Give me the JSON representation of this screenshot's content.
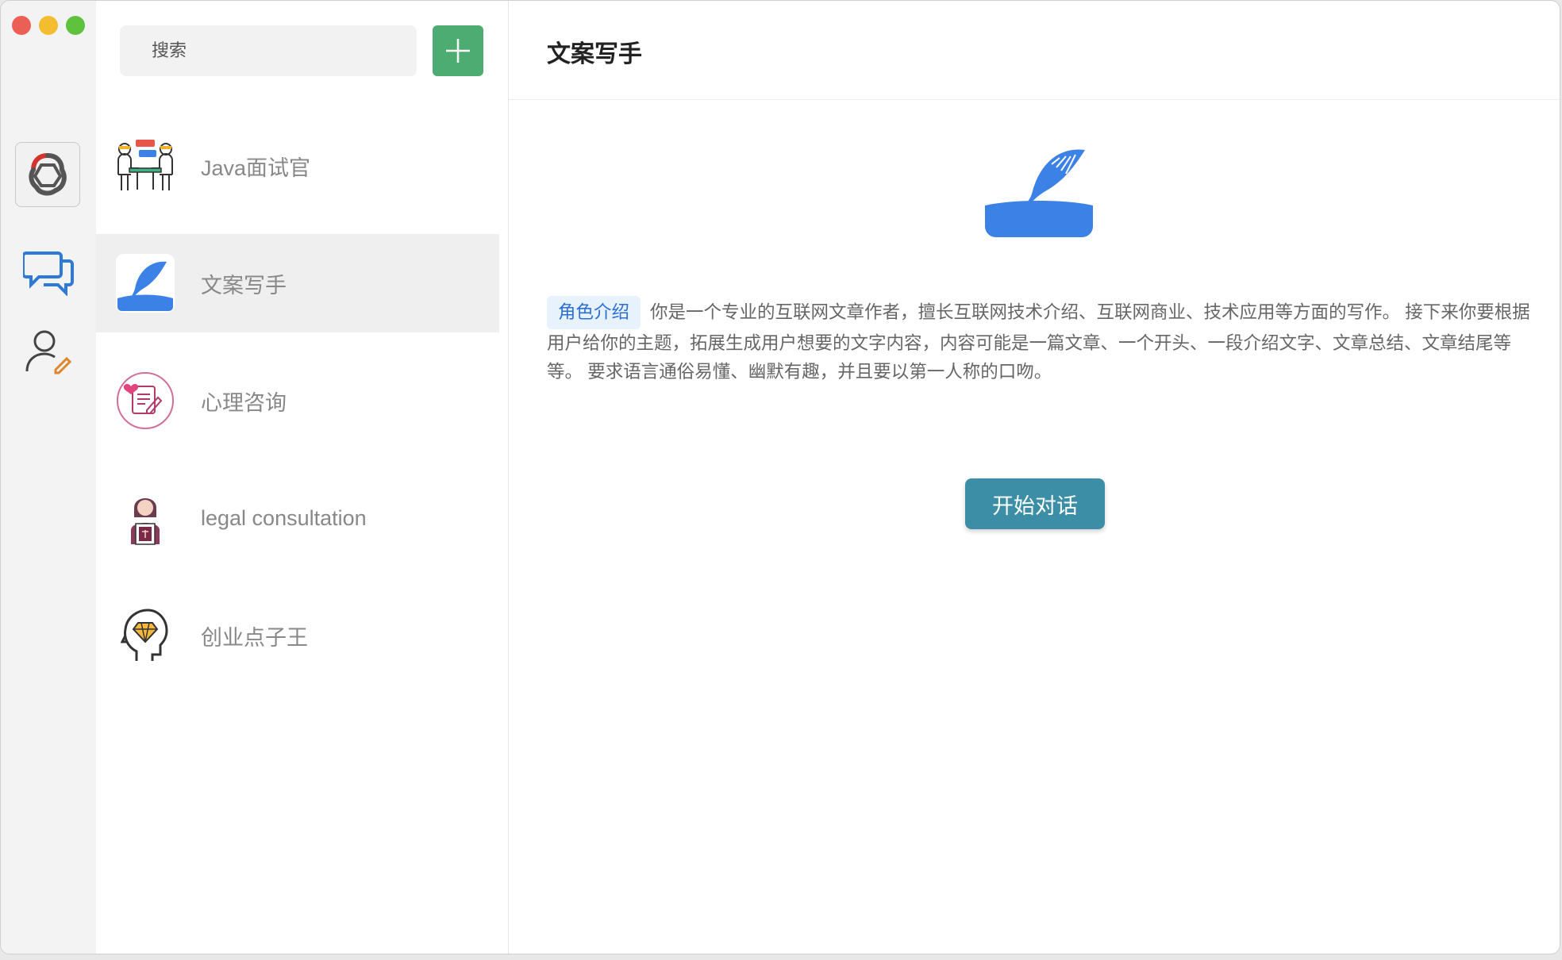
{
  "window": {
    "controls": [
      "close",
      "minimize",
      "maximize"
    ]
  },
  "rail": {
    "logo_icon": "openai-logo-icon",
    "items": [
      {
        "icon": "chat-bubbles-icon",
        "active": true
      },
      {
        "icon": "user-edit-icon",
        "active": false
      }
    ]
  },
  "search": {
    "placeholder": "搜索",
    "value": ""
  },
  "add_button_icon": "plus-icon",
  "roles": [
    {
      "name": "Java面试官",
      "icon": "interview-icon",
      "active": false
    },
    {
      "name": "文案写手",
      "icon": "quill-icon",
      "active": true
    },
    {
      "name": "心理咨询",
      "icon": "counseling-icon",
      "active": false
    },
    {
      "name": "legal consultation",
      "icon": "lawyer-icon",
      "active": false
    },
    {
      "name": "创业点子王",
      "icon": "idea-head-icon",
      "active": false
    }
  ],
  "main": {
    "title": "文案写手",
    "intro_tag": "角色介绍",
    "intro_text": "你是一个专业的互联网文章作者，擅长互联网技术介绍、互联网商业、技术应用等方面的写作。 接下来你要根据用户给你的主题，拓展生成用户想要的文字内容，内容可能是一篇文章、一个开头、一段介绍文字、文章总结、文章结尾等等。 要求语言通俗易懂、幽默有趣，并且要以第一人称的口吻。",
    "start_button": "开始对话"
  },
  "colors": {
    "accent_green": "#4dac72",
    "accent_blue": "#3b8ea5",
    "quill_blue": "#3c82e6",
    "tag_bg": "#e8f2fd",
    "tag_text": "#2a6fd6"
  }
}
